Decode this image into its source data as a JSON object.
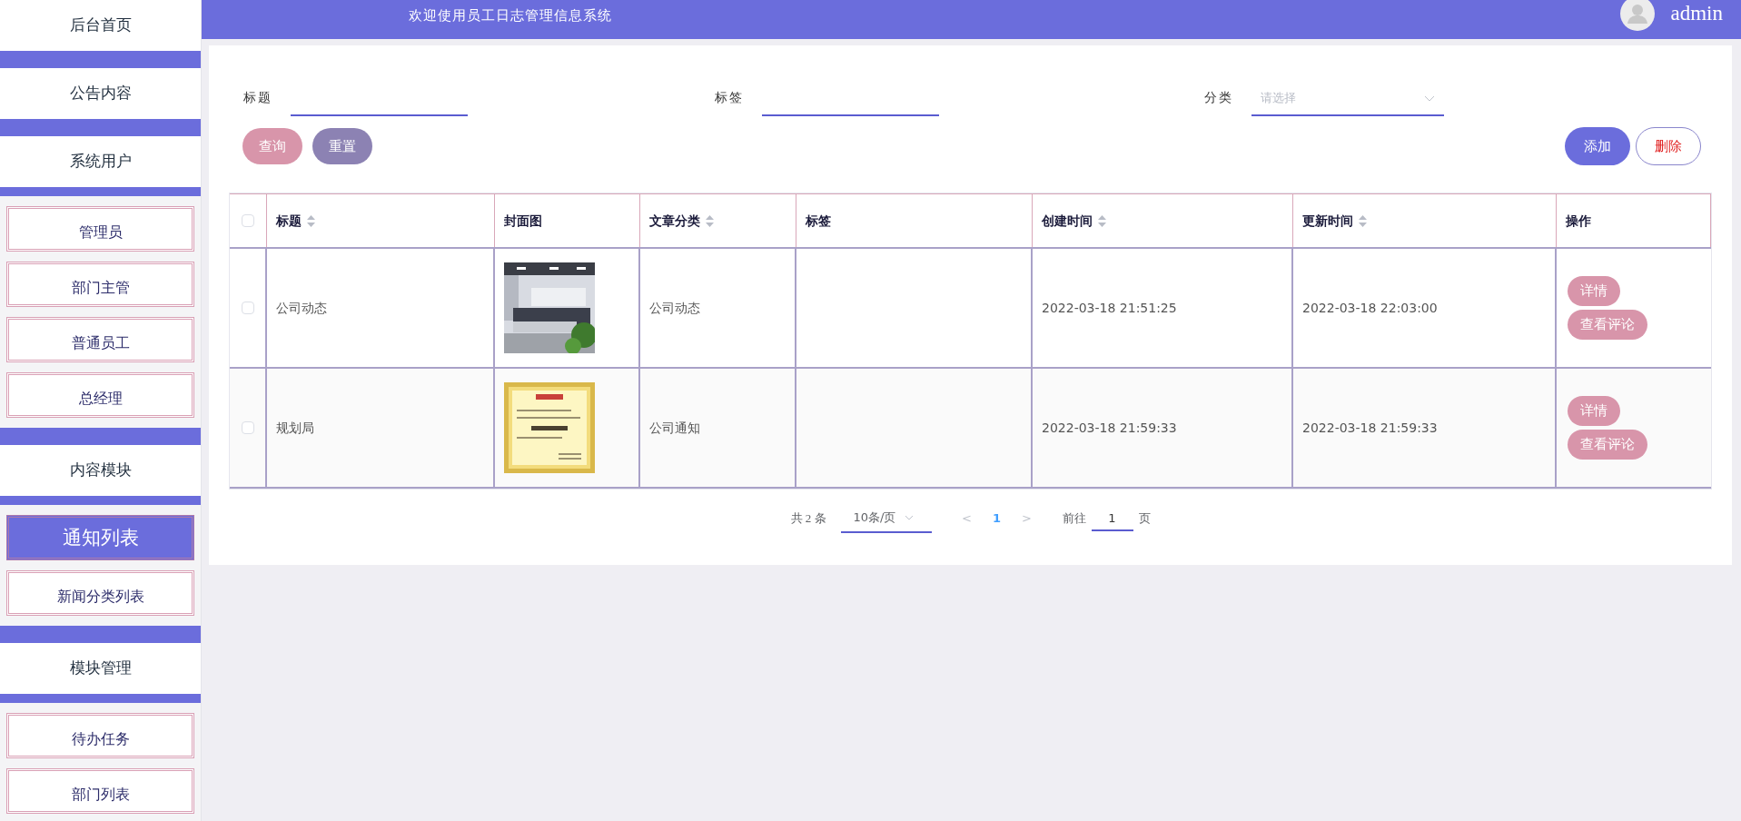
{
  "header": {
    "title": "欢迎使用员工日志管理信息系统",
    "user": "admin"
  },
  "sidebar": [
    {
      "label": "后台首页"
    },
    {
      "label": "公告内容"
    },
    {
      "label": "系统用户",
      "children": [
        {
          "label": "管理员",
          "selected": false
        },
        {
          "label": "部门主管",
          "selected": false
        },
        {
          "label": "普通员工",
          "selected": false
        },
        {
          "label": "总经理",
          "selected": false
        }
      ]
    },
    {
      "label": "内容模块",
      "children": [
        {
          "label": "通知列表",
          "selected": true
        },
        {
          "label": "新闻分类列表",
          "selected": false
        }
      ]
    },
    {
      "label": "模块管理",
      "children": [
        {
          "label": "待办任务",
          "selected": false
        },
        {
          "label": "部门列表",
          "selected": false
        }
      ]
    }
  ],
  "filters": [
    {
      "label": "标题",
      "kind": "text"
    },
    {
      "label": "标签",
      "kind": "text"
    },
    {
      "label": "分类",
      "kind": "select",
      "placeholder": "请选择"
    }
  ],
  "left_buttons": [
    {
      "label": "查询",
      "color": "#d895aa"
    },
    {
      "label": "重置",
      "color": "#8c82b3"
    }
  ],
  "right_buttons": [
    {
      "label": "添加",
      "kind": "primary"
    },
    {
      "label": "删除",
      "kind": "outline"
    }
  ],
  "table": {
    "header_checked": false,
    "columns": [
      {
        "label": "标题",
        "sortable": true
      },
      {
        "label": "封面图",
        "sortable": false
      },
      {
        "label": "文章分类",
        "sortable": true
      },
      {
        "label": "标签",
        "sortable": false
      },
      {
        "label": "创建时间",
        "sortable": true
      },
      {
        "label": "更新时间",
        "sortable": true
      },
      {
        "label": "操作",
        "sortable": false
      }
    ],
    "rows": [
      {
        "checked": false,
        "title": "公司动态",
        "cover": {
          "kind": "picture"
        },
        "category": "公司动态",
        "created": "2022-03-18 21:51:25",
        "updated": "2022-03-18 22:03:00",
        "actions": [
          "详情",
          "查看评论"
        ]
      },
      {
        "checked": false,
        "title": "规划局",
        "cover": {
          "kind": "picture"
        },
        "category": "公司通知",
        "created": "2022-03-18 21:59:33",
        "updated": "2022-03-18 21:59:33",
        "actions": [
          "详情",
          "查看评论"
        ]
      }
    ]
  },
  "pagination": {
    "total": "共 2 条",
    "page_size": "10条/页",
    "prev": "<",
    "pages": [
      {
        "label": "1",
        "selected": true
      }
    ],
    "next": ">",
    "goto_label": "前往",
    "goto_value": "1",
    "goto_suffix": "页"
  }
}
